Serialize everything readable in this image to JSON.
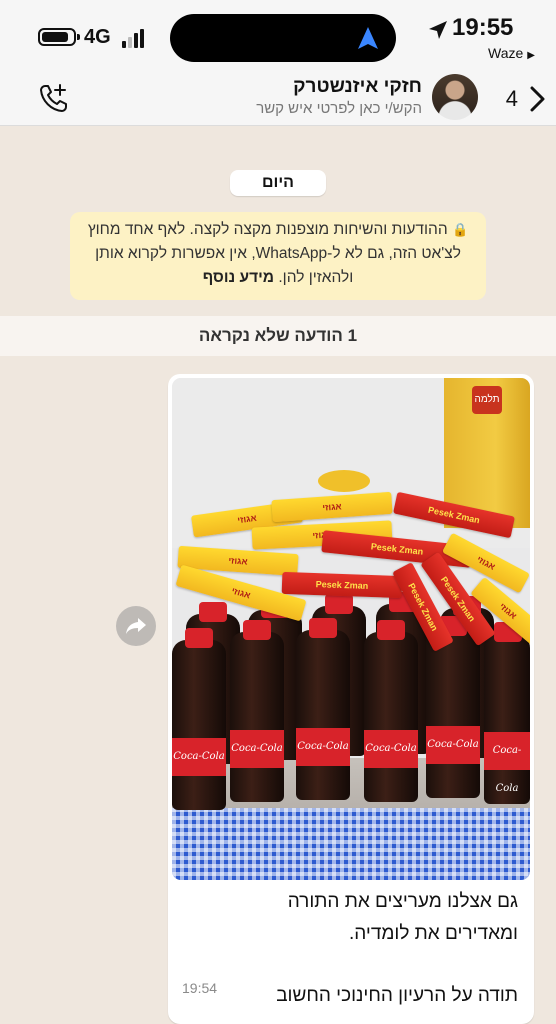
{
  "status_bar": {
    "network": "4G",
    "time": "19:55",
    "back_app": "Waze"
  },
  "header": {
    "unread_count": "4",
    "contact_name": "חזקי איזנשטרק",
    "contact_subtitle": "הקש/י כאן לפרטי איש קשר"
  },
  "chat": {
    "date_label": "היום",
    "encryption_notice": "ההודעות והשיחות מוצפנות מקצה לקצה. לאף אחד מחוץ לצ'אט הזה, גם לא ל-WhatsApp, אין אפשרות לקרוא אותן ולהאזין להן.",
    "encryption_link": "מידע נוסף",
    "unread_banner": "1 הודעה שלא נקראה",
    "message": {
      "caption_line1": "גם אצלנו מעריצים את התורה",
      "caption_line2": "ומאדירים את לומדיה.",
      "caption_line3": "תודה על הרעיון החינוכי החשוב",
      "time": "19:54",
      "photo_text": {
        "box_label": "תלמה",
        "bottle_label": "Coca-Cola",
        "wafer_label": "אגוזי",
        "bar_label": "Pesek Zman"
      }
    }
  },
  "colors": {
    "background": "#efe7de",
    "notice_bg": "#fdf2c5",
    "coca_cola_red": "#d8232a"
  }
}
